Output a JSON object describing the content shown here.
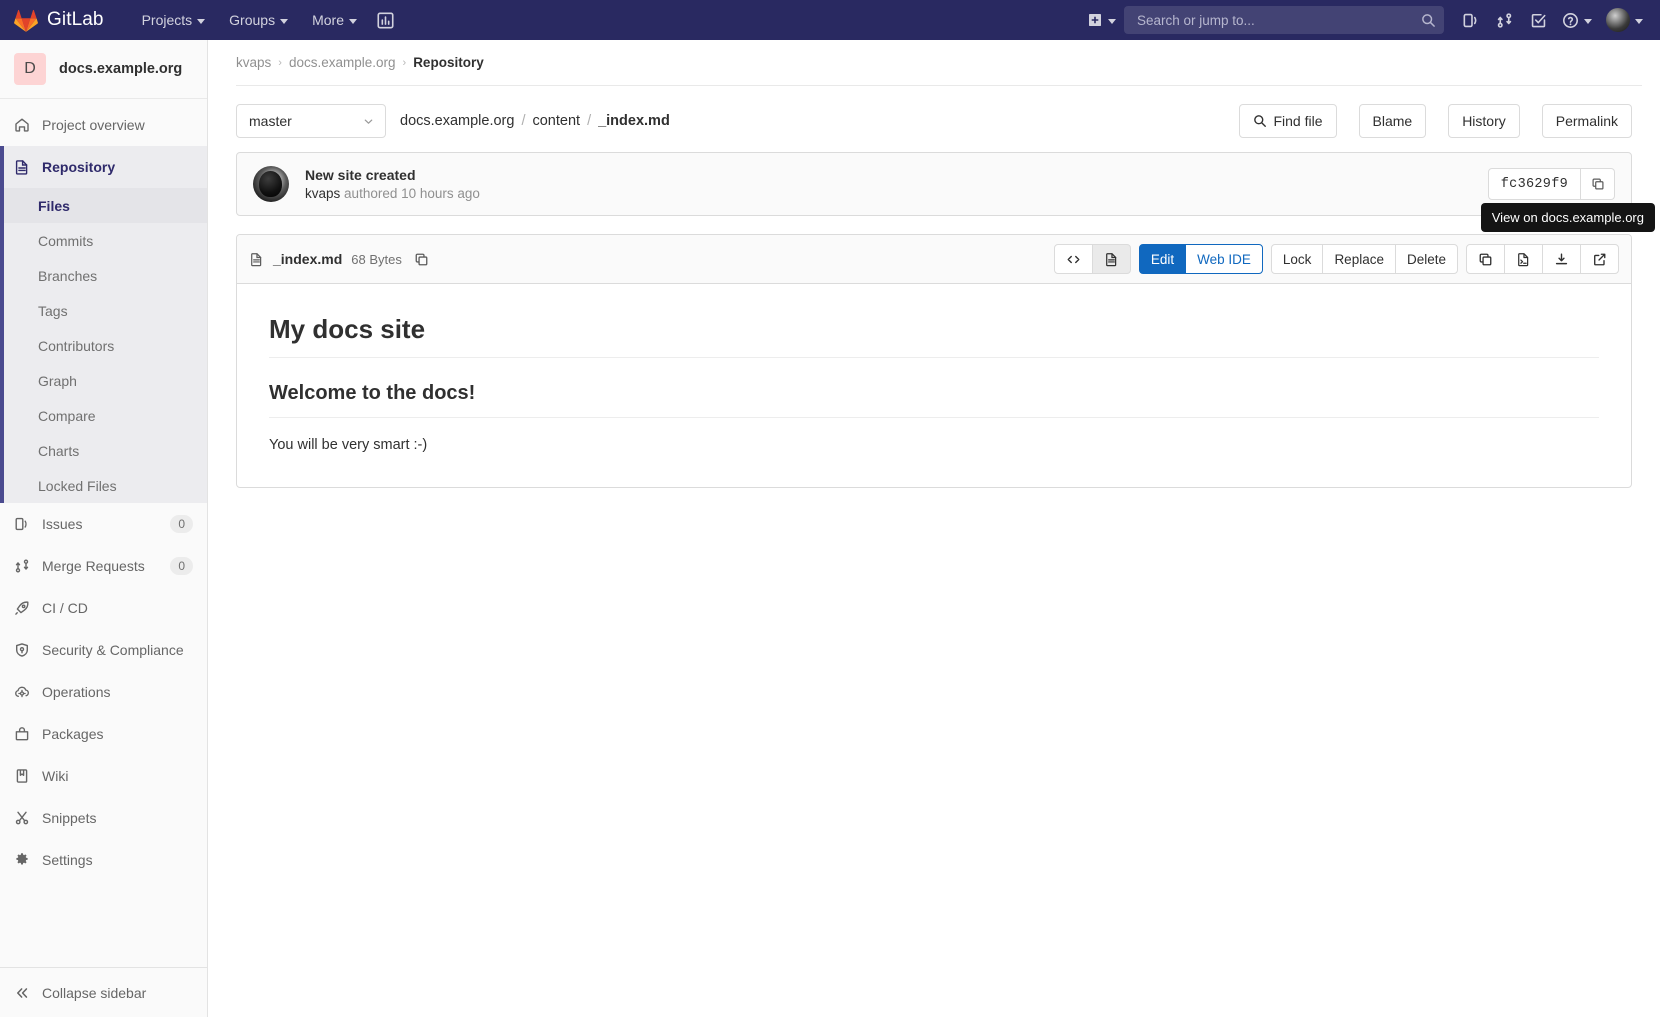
{
  "navbar": {
    "brand": "GitLab",
    "links": [
      {
        "label": "Projects",
        "name": "nav-projects"
      },
      {
        "label": "Groups",
        "name": "nav-groups"
      },
      {
        "label": "More",
        "name": "nav-more"
      }
    ],
    "analytics_icon": "chart-bar-icon",
    "plus_icon": "plus-square-icon",
    "search": {
      "placeholder": "Search or jump to...",
      "value": ""
    },
    "right_icons": [
      {
        "name": "todos-icon"
      },
      {
        "name": "merge-requests-icon"
      },
      {
        "name": "issues-checkbox-icon"
      },
      {
        "name": "help-question-icon"
      }
    ]
  },
  "sidebar": {
    "project": {
      "initial": "D",
      "name": "docs.example.org"
    },
    "items": [
      {
        "label": "Project overview",
        "icon": "home-icon",
        "active": false,
        "badge": ""
      },
      {
        "label": "Repository",
        "icon": "document-icon",
        "active": true,
        "badge": ""
      },
      {
        "label": "Issues",
        "icon": "issues-icon",
        "active": false,
        "badge": "0"
      },
      {
        "label": "Merge Requests",
        "icon": "merge-request-icon",
        "active": false,
        "badge": "0"
      },
      {
        "label": "CI / CD",
        "icon": "rocket-icon",
        "active": false,
        "badge": ""
      },
      {
        "label": "Security & Compliance",
        "icon": "shield-icon",
        "active": false,
        "badge": ""
      },
      {
        "label": "Operations",
        "icon": "cloud-gear-icon",
        "active": false,
        "badge": ""
      },
      {
        "label": "Packages",
        "icon": "package-icon",
        "active": false,
        "badge": ""
      },
      {
        "label": "Wiki",
        "icon": "book-icon",
        "active": false,
        "badge": ""
      },
      {
        "label": "Snippets",
        "icon": "scissors-icon",
        "active": false,
        "badge": ""
      },
      {
        "label": "Settings",
        "icon": "gear-icon",
        "active": false,
        "badge": ""
      }
    ],
    "repository_subitems": [
      {
        "label": "Files",
        "current": true
      },
      {
        "label": "Commits",
        "current": false
      },
      {
        "label": "Branches",
        "current": false
      },
      {
        "label": "Tags",
        "current": false
      },
      {
        "label": "Contributors",
        "current": false
      },
      {
        "label": "Graph",
        "current": false
      },
      {
        "label": "Compare",
        "current": false
      },
      {
        "label": "Charts",
        "current": false
      },
      {
        "label": "Locked Files",
        "current": false
      }
    ],
    "collapse_label": "Collapse sidebar",
    "collapse_icon": "chevron-double-left-icon"
  },
  "breadcrumb": {
    "items": [
      {
        "label": "kvaps",
        "current": false
      },
      {
        "label": "docs.example.org",
        "current": false
      },
      {
        "label": "Repository",
        "current": true
      }
    ],
    "separator": "›"
  },
  "file_header": {
    "branch": "master",
    "path_parts": [
      {
        "label": "docs.example.org",
        "last": false
      },
      {
        "label": "content",
        "last": false
      },
      {
        "label": "_index.md",
        "last": true
      }
    ],
    "path_separator": "/",
    "actions": [
      {
        "label": "Find file",
        "icon": "search-icon"
      },
      {
        "label": "Blame",
        "icon": ""
      },
      {
        "label": "History",
        "icon": ""
      },
      {
        "label": "Permalink",
        "icon": ""
      }
    ]
  },
  "commit": {
    "title": "New site created",
    "author": "kvaps",
    "meta_suffix": "authored 10 hours ago",
    "sha": "fc3629f9",
    "copy_icon": "copy-icon",
    "avatar": "user-avatar"
  },
  "file_card": {
    "file_name": "_index.md",
    "file_size": "68 Bytes",
    "file_icon": "file-text-icon",
    "copy_path_icon": "copy-icon",
    "view_toggles": [
      {
        "name": "source-view-toggle",
        "icon": "code-icon",
        "active": false
      },
      {
        "name": "rendered-view-toggle",
        "icon": "file-preview-icon",
        "active": true
      }
    ],
    "edit_buttons": [
      {
        "label": "Edit",
        "style": "primary"
      },
      {
        "label": "Web IDE",
        "style": "outline-primary"
      }
    ],
    "manage_buttons": [
      {
        "label": "Lock"
      },
      {
        "label": "Replace"
      },
      {
        "label": "Delete"
      }
    ],
    "icon_buttons": [
      {
        "name": "copy-contents-button",
        "icon": "copy-icon"
      },
      {
        "name": "open-raw-button",
        "icon": "raw-file-icon"
      },
      {
        "name": "download-button",
        "icon": "download-icon"
      },
      {
        "name": "external-link-button",
        "icon": "external-link-icon"
      }
    ],
    "tooltip": "View on docs.example.org"
  },
  "content": {
    "h1": "My docs site",
    "h2": "Welcome to the docs!",
    "paragraph": "You will be very smart :-)"
  },
  "colors": {
    "navbar_bg": "#292961",
    "accent_blue": "#1068bf",
    "sidebar_bg": "#fafafa",
    "active_purple": "#2f2a6b",
    "project_avatar_bg": "#fdd4d4",
    "tooltip_bg": "#141414"
  }
}
